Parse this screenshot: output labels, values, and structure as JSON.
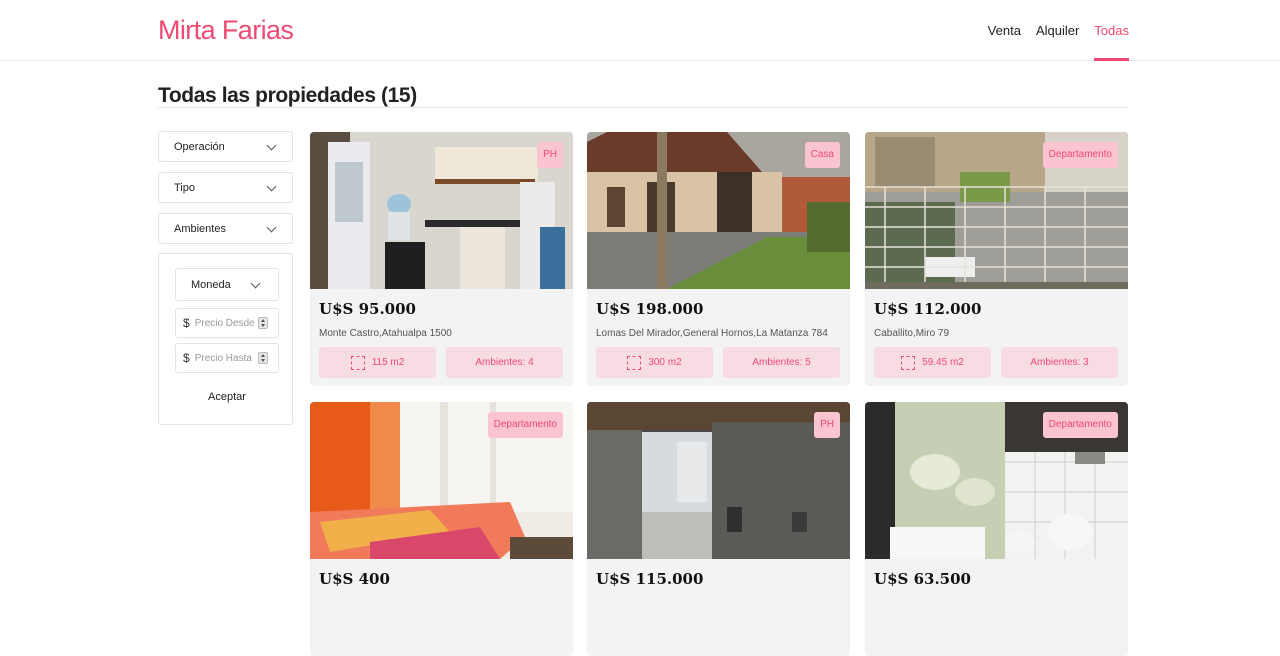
{
  "brand": "Mirta Farias",
  "nav": {
    "venta": "Venta",
    "alquiler": "Alquiler",
    "todas": "Todas"
  },
  "page_title": "Todas las propiedades (15)",
  "filters": {
    "operacion": "Operación",
    "tipo": "Tipo",
    "ambientes": "Ambientes",
    "moneda": "Moneda",
    "currency_symbol": "$",
    "precio_desde_placeholder": "Precio Desde",
    "precio_hasta_placeholder": "Precio Hasta",
    "aceptar": "Aceptar"
  },
  "colors": {
    "accent": "#ee4a72",
    "badge_bg": "#fbc4d1",
    "chip_bg": "#f8dce4",
    "card_bg": "#f3f3f3"
  },
  "listings": [
    {
      "badge": "PH",
      "price": "U$S 95.000",
      "address": "Monte Castro,Atahualpa 1500",
      "area": "115 m2",
      "ambientes": "Ambientes: 4",
      "photo": "kitchen"
    },
    {
      "badge": "Casa",
      "price": "U$S 198.000",
      "address": "Lomas Del Mirador,General Hornos,La Matanza 784",
      "area": "300 m2",
      "ambientes": "Ambientes: 5",
      "photo": "house-front"
    },
    {
      "badge": "Departamento",
      "price": "U$S 112.000",
      "address": "Caballito,Miro 79",
      "area": "59.45 m2",
      "ambientes": "Ambientes: 3",
      "photo": "balcony-street"
    },
    {
      "badge": "Departamento",
      "price": "U$S 400",
      "address": "",
      "area": "",
      "ambientes": "",
      "photo": "bedroom"
    },
    {
      "badge": "PH",
      "price": "U$S 115.000",
      "address": "",
      "area": "",
      "ambientes": "",
      "photo": "patio"
    },
    {
      "badge": "Departamento",
      "price": "U$S 63.500",
      "address": "",
      "area": "",
      "ambientes": "",
      "photo": "bathroom"
    }
  ]
}
